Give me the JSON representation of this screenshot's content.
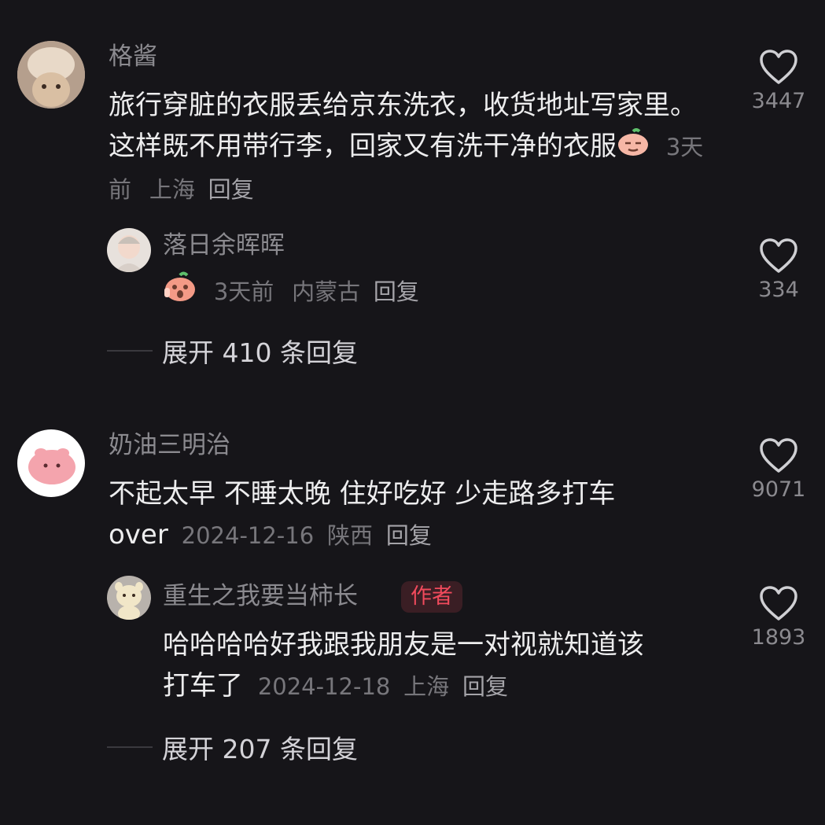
{
  "comments": [
    {
      "username": "格酱",
      "text": "旅行穿脏的衣服丢给京东洗衣，收货地址写家里。这样既不用带行李，回家又有洗干净的衣服",
      "time": "3天前",
      "location": "上海",
      "reply_label": "回复",
      "likes": "3447",
      "replies": [
        {
          "username": "落日余晖晖",
          "text": "",
          "time": "3天前",
          "location": "内蒙古",
          "reply_label": "回复",
          "likes": "334"
        }
      ],
      "expand_label": "展开 410 条回复"
    },
    {
      "username": "奶油三明治",
      "text_line1": "不起太早 不睡太晚 住好吃好 少走路多打车",
      "text_line2": "over",
      "time": "2024-12-16",
      "location": "陕西",
      "reply_label": "回复",
      "likes": "9071",
      "replies": [
        {
          "username": "重生之我要当柿长",
          "badge": "作者",
          "text_line1": "哈哈哈哈好我跟我朋友是一对视就知道该",
          "text_line2": "打车了",
          "time": "2024-12-18",
          "location": "上海",
          "reply_label": "回复",
          "likes": "1893"
        }
      ],
      "expand_label": "展开 207 条回复"
    }
  ],
  "icons": {
    "like": "heart-outline-icon",
    "emoji_smug": "smug-peach-emoji-icon",
    "emoji_cry": "crying-peach-emoji-icon"
  },
  "colors": {
    "background": "#161519",
    "badge_text": "#f04a5c",
    "badge_bg": "#3a1e24"
  }
}
